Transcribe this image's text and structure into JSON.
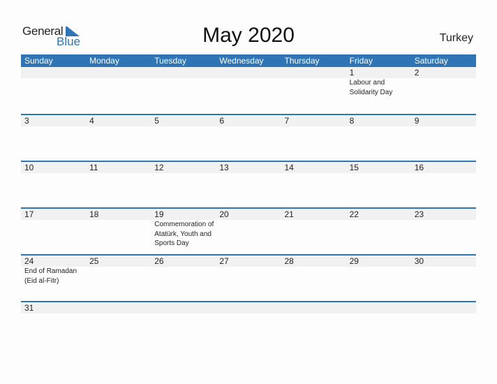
{
  "logo": {
    "general": "General",
    "blue": "Blue"
  },
  "title": "May 2020",
  "country": "Turkey",
  "colors": {
    "accent": "#2f74b5",
    "strip": "#f1f1f1"
  },
  "weekdays": [
    "Sunday",
    "Monday",
    "Tuesday",
    "Wednesday",
    "Thursday",
    "Friday",
    "Saturday"
  ],
  "weeks": [
    [
      {
        "d": "",
        "e": ""
      },
      {
        "d": "",
        "e": ""
      },
      {
        "d": "",
        "e": ""
      },
      {
        "d": "",
        "e": ""
      },
      {
        "d": "",
        "e": ""
      },
      {
        "d": "1",
        "e": "Labour and Solidarity Day"
      },
      {
        "d": "2",
        "e": ""
      }
    ],
    [
      {
        "d": "3",
        "e": ""
      },
      {
        "d": "4",
        "e": ""
      },
      {
        "d": "5",
        "e": ""
      },
      {
        "d": "6",
        "e": ""
      },
      {
        "d": "7",
        "e": ""
      },
      {
        "d": "8",
        "e": ""
      },
      {
        "d": "9",
        "e": ""
      }
    ],
    [
      {
        "d": "10",
        "e": ""
      },
      {
        "d": "11",
        "e": ""
      },
      {
        "d": "12",
        "e": ""
      },
      {
        "d": "13",
        "e": ""
      },
      {
        "d": "14",
        "e": ""
      },
      {
        "d": "15",
        "e": ""
      },
      {
        "d": "16",
        "e": ""
      }
    ],
    [
      {
        "d": "17",
        "e": ""
      },
      {
        "d": "18",
        "e": ""
      },
      {
        "d": "19",
        "e": "Commemoration of Atatürk, Youth and Sports Day"
      },
      {
        "d": "20",
        "e": ""
      },
      {
        "d": "21",
        "e": ""
      },
      {
        "d": "22",
        "e": ""
      },
      {
        "d": "23",
        "e": ""
      }
    ],
    [
      {
        "d": "24",
        "e": "End of Ramadan (Eid al-Fitr)"
      },
      {
        "d": "25",
        "e": ""
      },
      {
        "d": "26",
        "e": ""
      },
      {
        "d": "27",
        "e": ""
      },
      {
        "d": "28",
        "e": ""
      },
      {
        "d": "29",
        "e": ""
      },
      {
        "d": "30",
        "e": ""
      }
    ],
    [
      {
        "d": "31",
        "e": ""
      },
      {
        "d": "",
        "e": ""
      },
      {
        "d": "",
        "e": ""
      },
      {
        "d": "",
        "e": ""
      },
      {
        "d": "",
        "e": ""
      },
      {
        "d": "",
        "e": ""
      },
      {
        "d": "",
        "e": ""
      }
    ]
  ]
}
